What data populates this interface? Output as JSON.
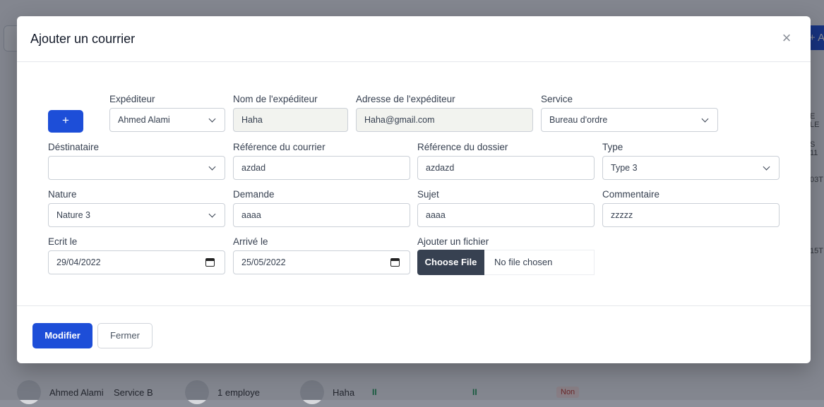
{
  "background": {
    "add_button_label": "+ A",
    "column_snippets": [
      "E LE",
      "S 11",
      "03T",
      "15T"
    ],
    "last_row": {
      "name": "Ahmed Alami",
      "service": "Service B",
      "employees": "1 employe",
      "sender": "Haha",
      "status1": "II",
      "status2": "II",
      "badge": "Non"
    }
  },
  "modal": {
    "title": "Ajouter un courrier",
    "close_icon": "close-icon",
    "add_expediteur_button": "+",
    "fields": {
      "expediteur": {
        "label": "Expéditeur",
        "value": "Ahmed Alami"
      },
      "nom_expediteur": {
        "label": "Nom de l'expéditeur",
        "value": "Haha"
      },
      "adresse_expediteur": {
        "label": "Adresse de l'expéditeur",
        "value": "Haha@gmail.com"
      },
      "service": {
        "label": "Service",
        "value": "Bureau d'ordre"
      },
      "destinataire": {
        "label": "Déstinataire",
        "value": ""
      },
      "reference_courrier": {
        "label": "Référence du courrier",
        "value": "azdad"
      },
      "reference_dossier": {
        "label": "Référence du dossier",
        "value": "azdazd"
      },
      "type": {
        "label": "Type",
        "value": "Type 3"
      },
      "nature": {
        "label": "Nature",
        "value": "Nature 3"
      },
      "demande": {
        "label": "Demande",
        "value": "aaaa"
      },
      "sujet": {
        "label": "Sujet",
        "value": "aaaa"
      },
      "commentaire": {
        "label": "Commentaire",
        "value": "zzzzz"
      },
      "ecrit_le": {
        "label": "Ecrit le",
        "value": "29/04/2022"
      },
      "arrive_le": {
        "label": "Arrivé le",
        "value": "25/05/2022"
      },
      "fichier": {
        "label": "Ajouter un fichier",
        "button": "Choose File",
        "status": "No file chosen"
      }
    },
    "footer": {
      "submit_label": "Modifier",
      "close_label": "Fermer"
    }
  },
  "colors": {
    "primary": "#1d4ed8",
    "file_button": "#374151",
    "readonly_field": "#f2f3ef"
  }
}
